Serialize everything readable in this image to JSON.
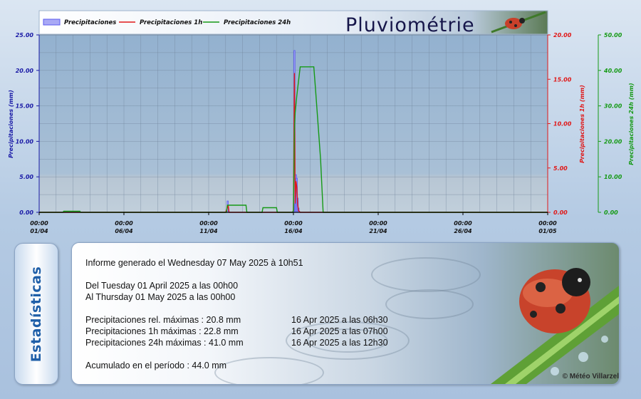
{
  "chart_data": {
    "type": "line",
    "title": "Pluviométrie",
    "x_tick_labels": [
      [
        "00:00",
        "01/04"
      ],
      [
        "00:00",
        "06/04"
      ],
      [
        "00:00",
        "11/04"
      ],
      [
        "00:00",
        "16/04"
      ],
      [
        "00:00",
        "21/04"
      ],
      [
        "00:00",
        "26/04"
      ],
      [
        "00:00",
        "01/05"
      ]
    ],
    "xlim_days": [
      0,
      30
    ],
    "axes": {
      "left": {
        "label": "Precipitaciones (mm)",
        "ylim": [
          0,
          25
        ],
        "ticks": [
          "0.00",
          "5.00",
          "10.00",
          "15.00",
          "20.00",
          "25.00"
        ],
        "color": "#1a1aa6"
      },
      "right1": {
        "label": "Precipitaciones 1h (mm)",
        "ylim": [
          0,
          20
        ],
        "ticks": [
          "0.00",
          "5.00",
          "10.00",
          "15.00",
          "20.00"
        ],
        "color": "#e01818"
      },
      "right2": {
        "label": "Precipitaciones 24h (mm)",
        "ylim": [
          0,
          50
        ],
        "ticks": [
          "0.00",
          "10.00",
          "20.00",
          "30.00",
          "40.00",
          "50.00"
        ],
        "color": "#169a16"
      }
    },
    "grid": true,
    "legend_position": "top-left",
    "series": [
      {
        "name": "Precipitaciones",
        "axis": "left",
        "color": "#5a5af0",
        "style": "bars",
        "x": [
          11.1,
          11.12,
          15.06,
          15.1,
          15.15,
          15.2,
          15.25,
          15.3
        ],
        "y": [
          0.6,
          1.6,
          22.8,
          1.2,
          5.3,
          4.8,
          2.0,
          0.6
        ]
      },
      {
        "name": "Precipitaciones 1h",
        "axis": "right1",
        "color": "#e01818",
        "style": "line",
        "x": [
          0,
          11.0,
          11.1,
          11.15,
          11.2,
          14.95,
          15.0,
          15.06,
          15.1,
          15.15,
          15.2,
          15.25,
          15.3,
          15.4,
          30
        ],
        "y": [
          0,
          0,
          0.5,
          0.8,
          0,
          0,
          0.2,
          15.7,
          1.0,
          3.5,
          2.8,
          1.0,
          0.2,
          0,
          0
        ]
      },
      {
        "name": "Precipitaciones 24h",
        "axis": "right2",
        "color": "#169a16",
        "style": "line",
        "x": [
          0,
          1.4,
          1.45,
          2.4,
          2.45,
          11.05,
          11.1,
          12.2,
          12.25,
          13.15,
          13.2,
          14.0,
          14.05,
          14.95,
          15.0,
          15.06,
          15.1,
          15.2,
          15.4,
          16.2,
          16.3,
          16.6,
          16.75,
          30
        ],
        "y": [
          0,
          0,
          0.3,
          0.3,
          0,
          0,
          2.0,
          2.0,
          0,
          0,
          1.3,
          1.3,
          0,
          0,
          0.5,
          23.0,
          28.0,
          33.0,
          41.0,
          41.0,
          35.0,
          15.0,
          0,
          0
        ]
      }
    ]
  },
  "stats": {
    "tab_label": "Estadísticas",
    "report_generated": "Informe generado el Wednesday 07 May 2025 à 10h51",
    "period_from": "Del Tuesday 01 April 2025 a las 00h00",
    "period_to": "Al Thursday 01 May 2025 a las 00h00",
    "rel_max_label": "Precipitaciones rel. máximas : 20.8 mm",
    "rel_max_date": "16 Apr 2025 a las 06h30",
    "max_1h_label": "Precipitaciones 1h máximas : 22.8 mm",
    "max_1h_date": "16 Apr 2025 a las 07h00",
    "max_24h_label": "Precipitaciones 24h máximas : 41.0 mm",
    "max_24h_date": "16 Apr 2025 a las 12h30",
    "cumulative": "Acumulado en el período : 44.0 mm",
    "copyright": "© Météo Villarzel"
  },
  "colors": {
    "plot_bg_top": "#9cb7d2",
    "plot_bg_bottom": "#b8c9d8",
    "grid": "#6f8299",
    "title_bar": "#e8eef6"
  }
}
